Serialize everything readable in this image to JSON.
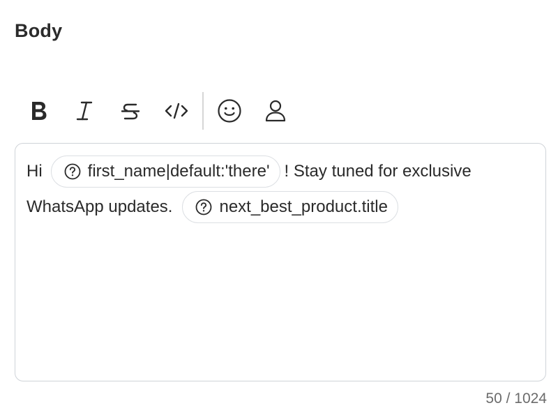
{
  "section": {
    "title": "Body"
  },
  "toolbar": {
    "buttons": [
      {
        "name": "bold",
        "icon": "bold-icon"
      },
      {
        "name": "italic",
        "icon": "italic-icon"
      },
      {
        "name": "strikethrough",
        "icon": "strikethrough-icon"
      },
      {
        "name": "code",
        "icon": "code-icon"
      },
      {
        "name": "emoji",
        "icon": "smiley-icon"
      },
      {
        "name": "personalization",
        "icon": "person-icon"
      }
    ]
  },
  "editor": {
    "text_before_first_chip": "Hi",
    "chip_1": {
      "label": "first_name|default:'there'",
      "icon": "question-circle-icon"
    },
    "text_after_first_chip": "! Stay tuned for exclusive",
    "text_line_2": "WhatsApp updates.",
    "chip_2": {
      "label": "next_best_product.title",
      "icon": "question-circle-icon"
    }
  },
  "counter": {
    "text": "50 / 1024"
  },
  "colors": {
    "border": "#cfd3d8",
    "chip_border": "#dcdfe3",
    "text": "#2a2a2a",
    "muted": "#6b6b6b"
  }
}
